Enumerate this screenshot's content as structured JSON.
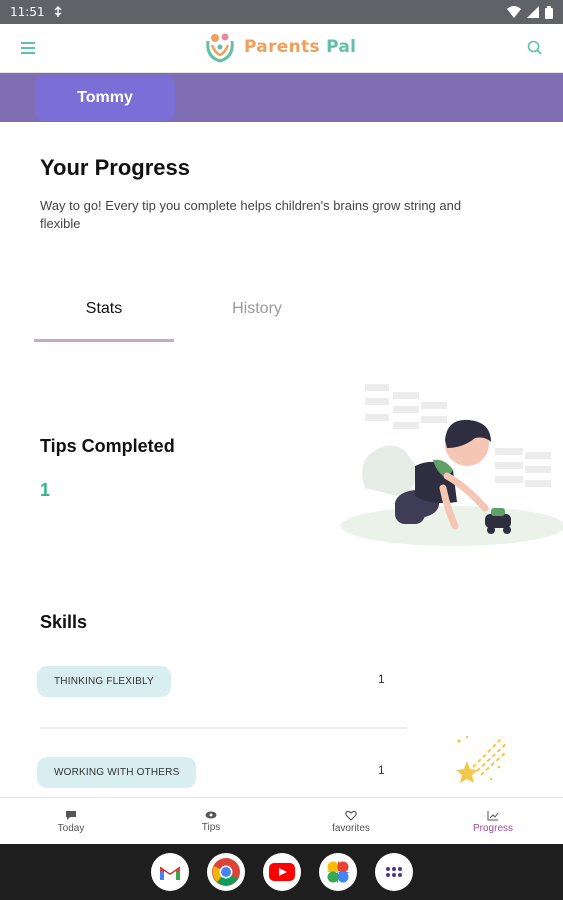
{
  "status_bar": {
    "time": "11:51"
  },
  "app": {
    "name_part1": "Parents",
    "name_part2": "Pal"
  },
  "child_tab": {
    "label": "Tommy"
  },
  "page": {
    "title": "Your Progress",
    "subtitle": "Way to go! Every tip you complete helps children's brains grow string and flexible"
  },
  "tabs": {
    "stats": "Stats",
    "history": "History"
  },
  "tips_completed": {
    "label": "Tips Completed",
    "value": "1"
  },
  "skills": {
    "title": "Skills",
    "items": [
      {
        "label": "THINKING FLEXIBLY",
        "count": "1"
      },
      {
        "label": "WORKING WITH OTHERS",
        "count": "1"
      }
    ]
  },
  "bottom_nav": [
    {
      "label": "Today",
      "icon": "chat-bubble-icon"
    },
    {
      "label": "Tips",
      "icon": "eye-icon"
    },
    {
      "label": "favorites",
      "icon": "heart-icon"
    },
    {
      "label": "Progress",
      "icon": "chart-icon"
    }
  ],
  "colors": {
    "accent": "#7b6ed6",
    "child_bar": "#7f6fb2",
    "count_green": "#33b38f",
    "chip_bg": "#d8eef0",
    "active_nav": "#9b4fa0"
  },
  "dock_apps": [
    "gmail-icon",
    "chrome-icon",
    "youtube-icon",
    "photos-icon",
    "app-drawer-icon"
  ]
}
